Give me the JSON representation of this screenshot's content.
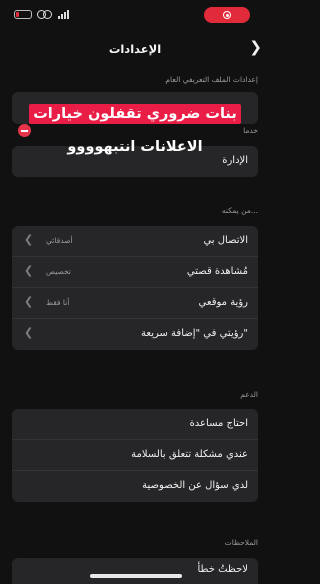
{
  "header": {
    "title": "الإعدادات",
    "back_icon": "chevron-right-icon"
  },
  "overlay_caption": {
    "line1": "بنات ضروري تقفلون خيارات",
    "line2": "الاعلانات انتبهوووو"
  },
  "sections": {
    "profile": {
      "label": "إعدادات الملف التعريفي العام"
    },
    "partial": {
      "label": "خدما",
      "rows": [
        {
          "label": "الإدارة"
        }
      ]
    },
    "who_can": {
      "label": "من يمكنه...",
      "rows": [
        {
          "label": "الاتصال بي",
          "value": "أصدقائي"
        },
        {
          "label": "مُشاهدة قصتي",
          "value": "تخصيص"
        },
        {
          "label": "رؤية موقعي",
          "value": "أنا فقط"
        },
        {
          "label": "رؤيتي في \"إضافة سريعة\"",
          "value": ""
        }
      ]
    },
    "support": {
      "label": "الدعم",
      "rows": [
        {
          "label": "احتاج مساعدة"
        },
        {
          "label": "عندي مشكلة تتعلق بالسلامة"
        },
        {
          "label": "لدي سؤال عن الخصوصية"
        }
      ]
    },
    "feedback": {
      "label": "الملاحظات",
      "rows": [
        {
          "label": "لاحظتُ خطأ"
        }
      ]
    }
  },
  "colors": {
    "background": "#111111",
    "cell": "#262628",
    "accent_red": "#e91d45"
  }
}
